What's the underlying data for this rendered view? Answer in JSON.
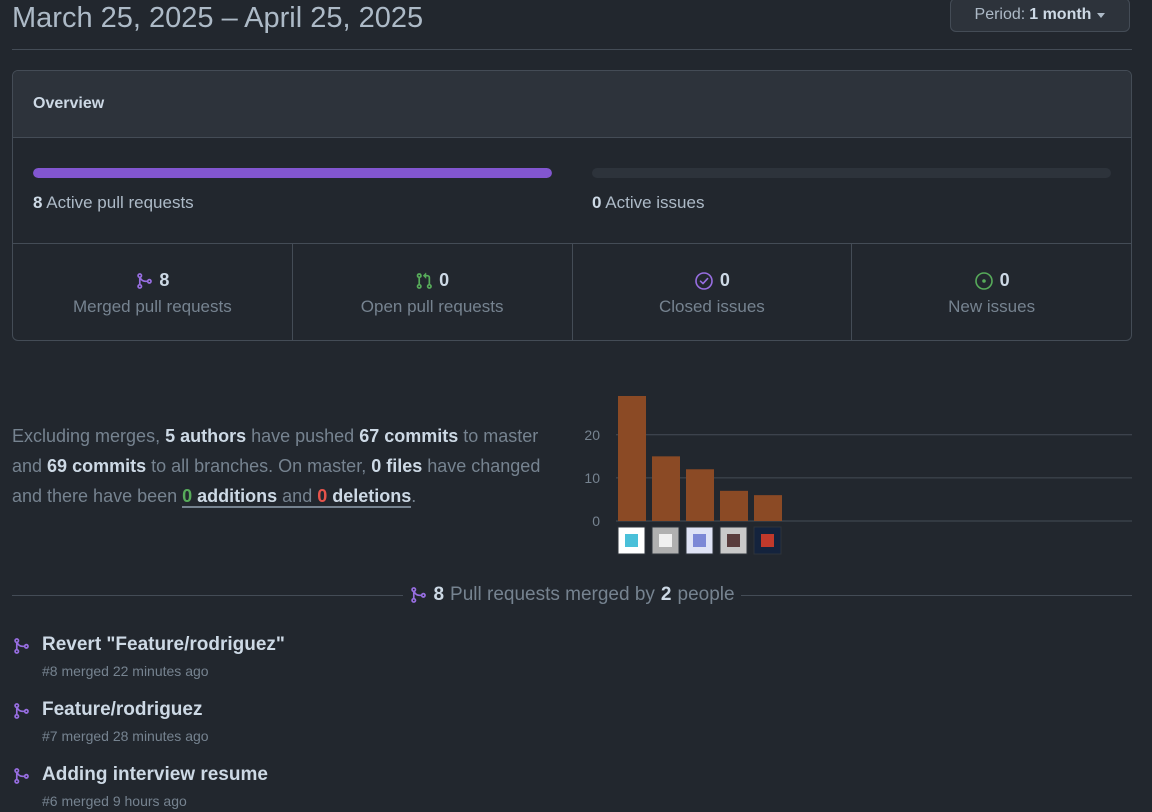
{
  "header": {
    "date_range": "March 25, 2025 – April 25, 2025",
    "period_prefix": "Period:",
    "period_value": "1 month"
  },
  "overview": {
    "title": "Overview",
    "active_prs": {
      "count": "8",
      "label": "Active pull requests",
      "fill": 1.0,
      "color": "#8256d0"
    },
    "active_issues": {
      "count": "0",
      "label": "Active issues",
      "fill": 0.0
    },
    "stats": [
      {
        "value": "8",
        "label": "Merged pull requests",
        "icon": "merged-pr-icon",
        "color": "#986ee2"
      },
      {
        "value": "0",
        "label": "Open pull requests",
        "icon": "open-pr-icon",
        "color": "#57ab5a"
      },
      {
        "value": "0",
        "label": "Closed issues",
        "icon": "closed-issue-icon",
        "color": "#986ee2"
      },
      {
        "value": "0",
        "label": "New issues",
        "icon": "new-issue-icon",
        "color": "#57ab5a"
      }
    ]
  },
  "summary": {
    "t1": "Excluding merges, ",
    "authors": "5 authors",
    "t2": " have pushed ",
    "commits_master": "67 commits",
    "t3": " to master and ",
    "commits_all": "69 commits",
    "t4": " to all branches. On master, ",
    "files": "0 files",
    "t5": " have changed and there have been ",
    "additions_num": "0",
    "additions_word": "additions",
    "t6": " and ",
    "deletions_num": "0",
    "deletions_word": "deletions",
    "t7": "."
  },
  "chart_data": {
    "type": "bar",
    "categories": [
      "author-1",
      "author-2",
      "author-3",
      "author-4",
      "author-5"
    ],
    "values": [
      29,
      15,
      12,
      7,
      6
    ],
    "yticks": [
      0,
      10,
      20
    ],
    "ylim": [
      0,
      29
    ],
    "bar_color": "#8b4a25",
    "grid": true
  },
  "merged_section": {
    "count": "8",
    "text1": "Pull requests merged by",
    "people_count": "2",
    "text2": "people"
  },
  "pull_requests": [
    {
      "title": "Revert \"Feature/rodriguez\"",
      "meta": "#8 merged 22 minutes ago"
    },
    {
      "title": "Feature/rodriguez",
      "meta": "#7 merged 28 minutes ago"
    },
    {
      "title": "Adding interview resume",
      "meta": "#6 merged 9 hours ago"
    }
  ]
}
